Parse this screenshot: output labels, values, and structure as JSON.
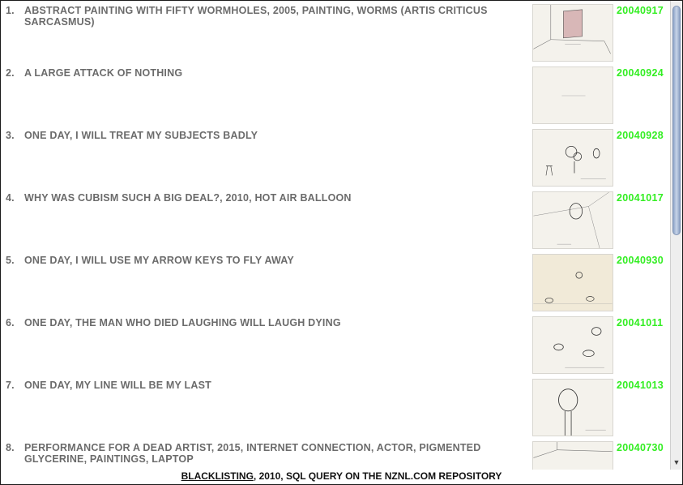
{
  "entries": [
    {
      "num": "1.",
      "title": "ABSTRACT PAINTING WITH FIFTY WORMHOLES, 2005, PAINTING, WORMS (ARTIS CRITICUS SARCASMUS)",
      "date": "20040917",
      "thumbnail": "room-with-panel-sketch"
    },
    {
      "num": "2.",
      "title": "A LARGE ATTACK OF NOTHING",
      "date": "20040924",
      "thumbnail": "blank-sheet-sketch"
    },
    {
      "num": "3.",
      "title": "ONE DAY, I WILL TREAT MY SUBJECTS BADLY",
      "date": "20040928",
      "thumbnail": "heads-on-tree-sketch"
    },
    {
      "num": "4.",
      "title": "WHY WAS CUBISM SUCH A BIG DEAL?, 2010, HOT AIR BALLOON",
      "date": "20041017",
      "thumbnail": "balloon-in-room-sketch"
    },
    {
      "num": "5.",
      "title": "ONE DAY, I WILL USE MY ARROW KEYS TO FLY AWAY",
      "date": "20040930",
      "thumbnail": "lightbulb-and-figures-sketch"
    },
    {
      "num": "6.",
      "title": "ONE DAY, THE MAN WHO DIED LAUGHING WILL LAUGH DYING",
      "date": "20041011",
      "thumbnail": "laughing-heads-sketch"
    },
    {
      "num": "7.",
      "title": "ONE DAY, MY LINE WILL BE MY LAST",
      "date": "20041013",
      "thumbnail": "head-on-pole-sketch"
    },
    {
      "num": "8.",
      "title": "PERFORMANCE FOR A DEAD ARTIST, 2015, INTERNET CONNECTION, ACTOR, PIGMENTED GLYCERINE, PAINTINGS, LAPTOP",
      "date": "20040730",
      "thumbnail": "room-corner-sketch"
    }
  ],
  "caption": {
    "link": "BLACKLISTING",
    "rest": ", 2010, SQL QUERY ON THE NZNL.COM REPOSITORY"
  },
  "scrollbar": {
    "down_arrow": "▼"
  },
  "colors": {
    "title": "#6b6b6b",
    "date": "#33ee22",
    "caption": "#111111"
  }
}
